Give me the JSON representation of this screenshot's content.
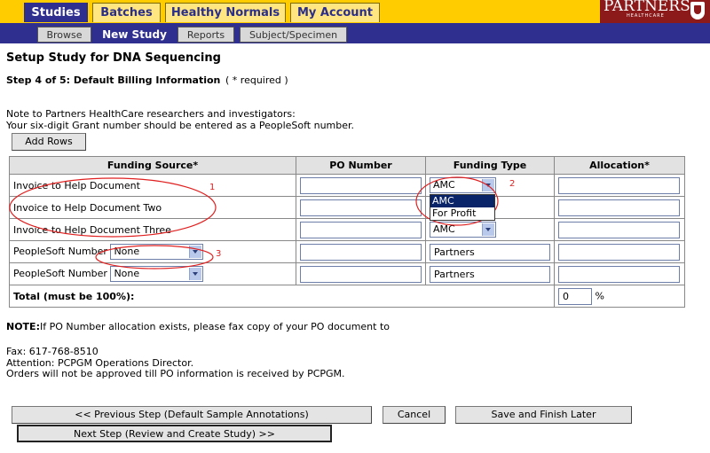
{
  "nav": {
    "tabs": [
      "Studies",
      "Batches",
      "Healthy Normals",
      "My Account"
    ],
    "subtabs": [
      "Browse",
      "New Study",
      "Reports",
      "Subject/Specimen"
    ]
  },
  "logo": {
    "name": "PARTNERS.",
    "sub": "HEALTHCARE"
  },
  "page": {
    "title": "Setup Study for DNA Sequencing",
    "step": "Step 4 of 5: Default Billing Information",
    "required_note": "( * required )",
    "note_line1": "Note to Partners HealthCare researchers and investigators:",
    "note_line2": "Your six-digit Grant number should be entered as a PeopleSoft number.",
    "add_rows": "Add Rows"
  },
  "table": {
    "headers": [
      "Funding Source*",
      "PO Number",
      "Funding Type",
      "Allocation*"
    ],
    "rows": [
      {
        "source_label": "Invoice to",
        "source_value": "Help Document",
        "type": "AMC"
      },
      {
        "source_label": "Invoice to",
        "source_value": "Help Document Two",
        "type": ""
      },
      {
        "source_label": "Invoice to",
        "source_value": "Help Document Three",
        "type": "AMC"
      },
      {
        "source_label": "PeopleSoft Number",
        "source_select": "None",
        "type": "Partners"
      },
      {
        "source_label": "PeopleSoft Number",
        "source_select": "None",
        "type": "Partners"
      }
    ],
    "total_label": "Total (must be 100%):",
    "total_value": "0",
    "total_unit": "%",
    "dropdown_options": [
      "AMC",
      "For Profit"
    ]
  },
  "annotations": [
    "1",
    "2",
    "3"
  ],
  "footer": {
    "note_bold": "NOTE:",
    "note_text": "If PO Number allocation exists, please fax copy of your PO document to",
    "fax": "Fax: 617-768-8510",
    "attention": "Attention: PCPGM Operations Director.",
    "orders": "Orders will not be approved till PO information is received by PCPGM."
  },
  "buttons": {
    "previous": "<< Previous Step (Default Sample Annotations)",
    "cancel": "Cancel",
    "save": "Save and Finish Later",
    "next": "Next Step (Review and Create Study) >>"
  },
  "colors": {
    "nav_yellow": "#ffcc00",
    "nav_blue": "#2e2f8f",
    "annotation_red": "#e02020",
    "logo_red": "#8c1a1a"
  }
}
